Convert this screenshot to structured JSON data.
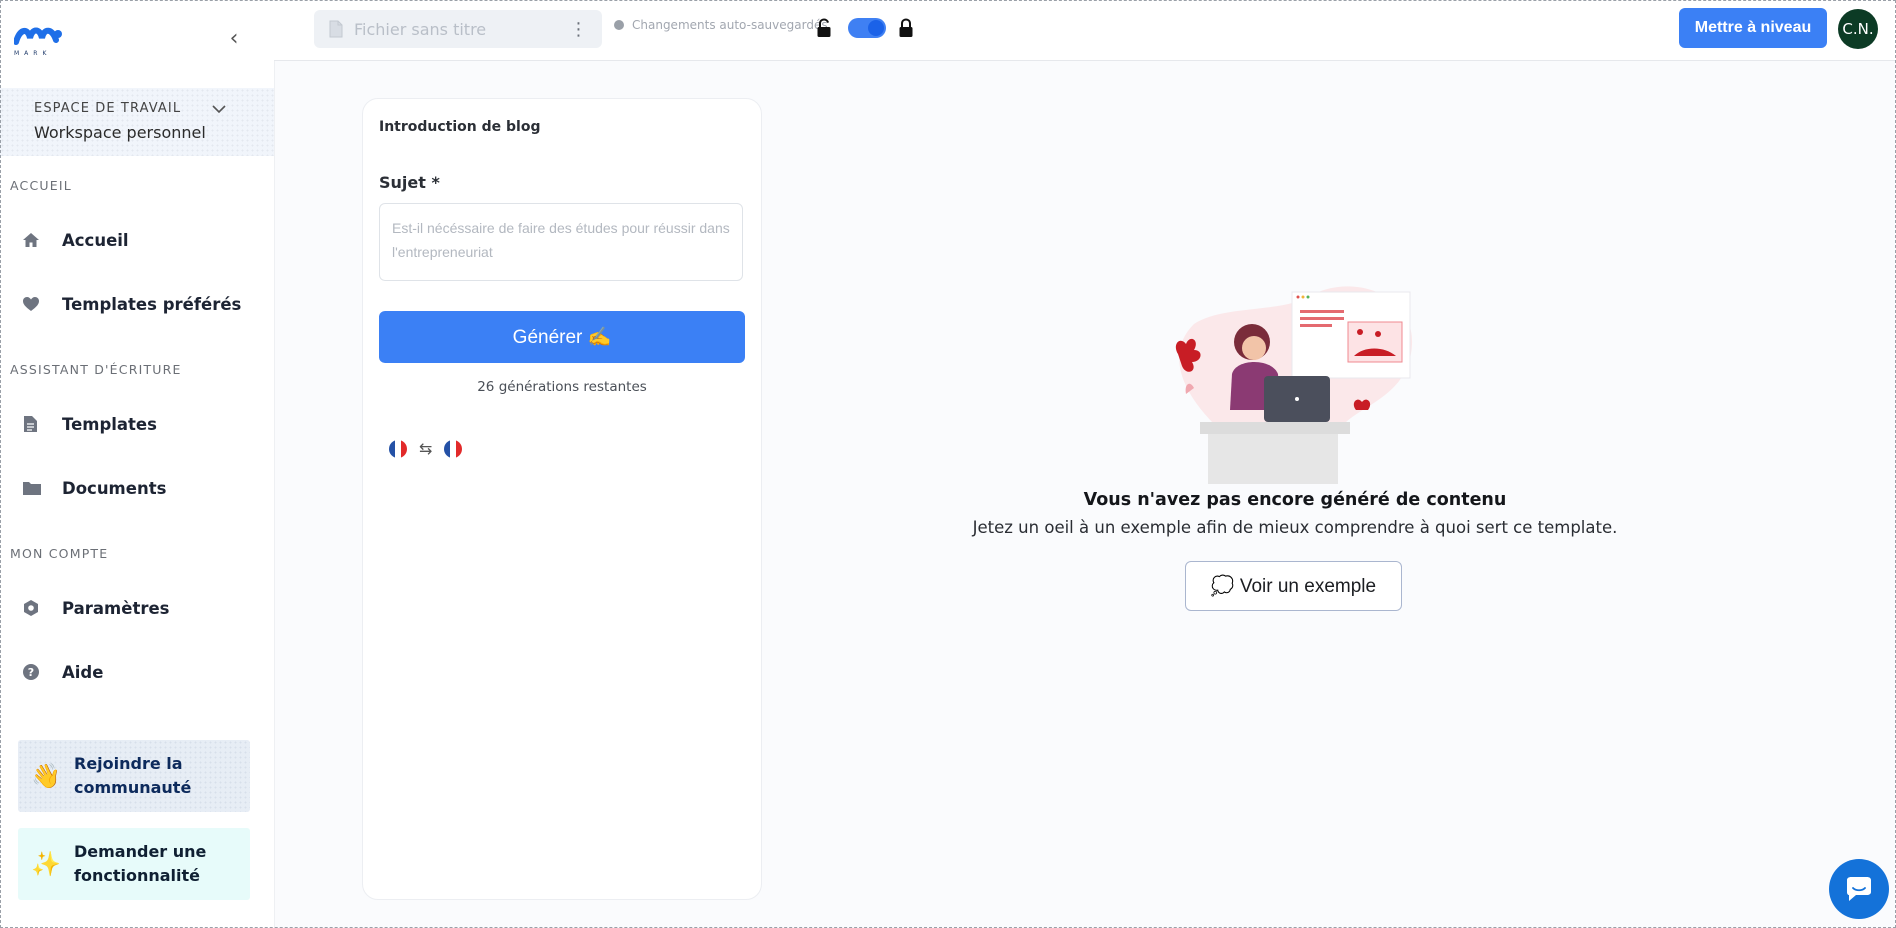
{
  "sidebar": {
    "workspace": {
      "label": "ESPACE DE TRAVAIL",
      "name": "Workspace personnel"
    },
    "sections": {
      "home": "ACCUEIL",
      "writing": "ASSISTANT D'ÉCRITURE",
      "account": "MON COMPTE"
    },
    "items": {
      "home": "Accueil",
      "favorites": "Templates préférés",
      "templates": "Templates",
      "documents": "Documents",
      "settings": "Paramètres",
      "help": "Aide"
    },
    "cards": {
      "community": {
        "emoji": "👋",
        "line1": "Rejoindre la",
        "line2": "communauté"
      },
      "feature": {
        "emoji": "✨",
        "line1": "Demander une",
        "line2": "fonctionnalité"
      }
    }
  },
  "topbar": {
    "file_name": "Fichier sans titre",
    "autosave": "Changements auto-sauvegardés",
    "upgrade_label": "Mettre à niveau",
    "avatar_initials": "C.N."
  },
  "form": {
    "title": "Introduction de blog",
    "subject_label": "Sujet *",
    "subject_placeholder": "Est-il nécéssaire de faire des études pour réussir dans l'entrepreneuriat",
    "generate_label": "Générer ✍️",
    "remaining": "26 générations restantes"
  },
  "empty_state": {
    "title": "Vous n'avez pas encore généré de contenu",
    "subtitle": "Jetez un oeil à un exemple afin de mieux comprendre à quoi sert ce template.",
    "example_label": "💭 Voir un exemple"
  },
  "colors": {
    "primary": "#3b80f5",
    "avatar": "#0c3b25",
    "chat": "#1472d9"
  }
}
